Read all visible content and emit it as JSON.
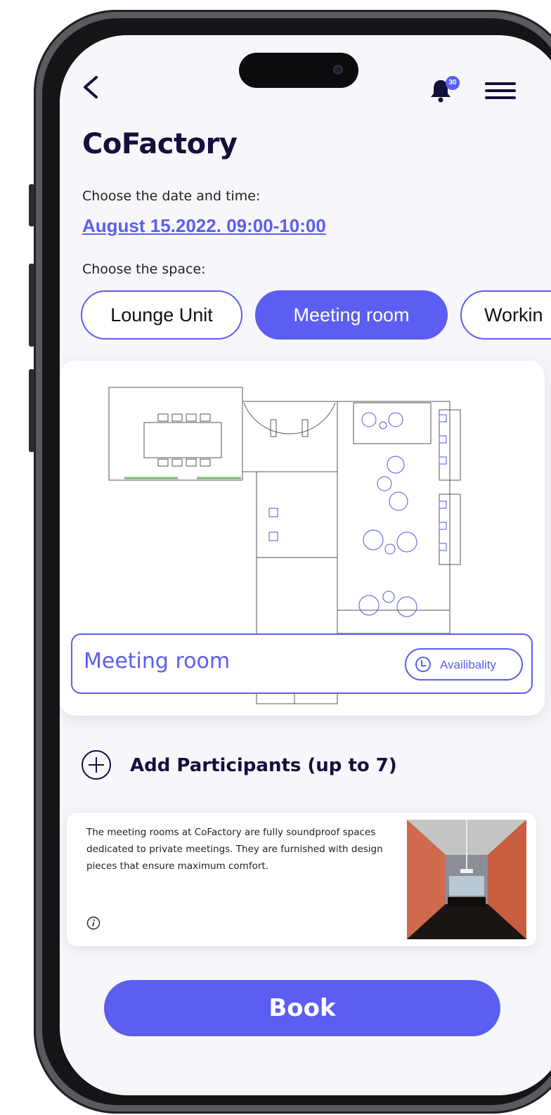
{
  "header": {
    "notification_count": "30",
    "title": "CoFactory"
  },
  "booking": {
    "date_label": "Choose the date and time:",
    "date_value": "August 15.2022. 09:00-10:00",
    "space_label": "Choose the space:",
    "spaces": [
      {
        "label": "Lounge Unit",
        "active": false
      },
      {
        "label": "Meeting room",
        "active": true
      },
      {
        "label": "Workin",
        "active": false
      }
    ]
  },
  "floorplan": {
    "selected_room": "Meeting room",
    "availability_label": "Availibality"
  },
  "participants": {
    "label": "Add Participants (up to 7)"
  },
  "info": {
    "description": "The meeting rooms at CoFactory are fully soundproof spaces dedicated to private meetings. They are furnished with design pieces that ensure maximum comfort."
  },
  "actions": {
    "book_label": "Book"
  },
  "colors": {
    "accent": "#5b5ef0",
    "title": "#13103c",
    "background": "#f7f7fb"
  },
  "icons": {
    "back": "chevron-left-icon",
    "bell": "bell-icon",
    "menu": "hamburger-menu-icon",
    "clock": "clock-icon",
    "plus": "plus-circle-icon",
    "info": "info-icon"
  }
}
